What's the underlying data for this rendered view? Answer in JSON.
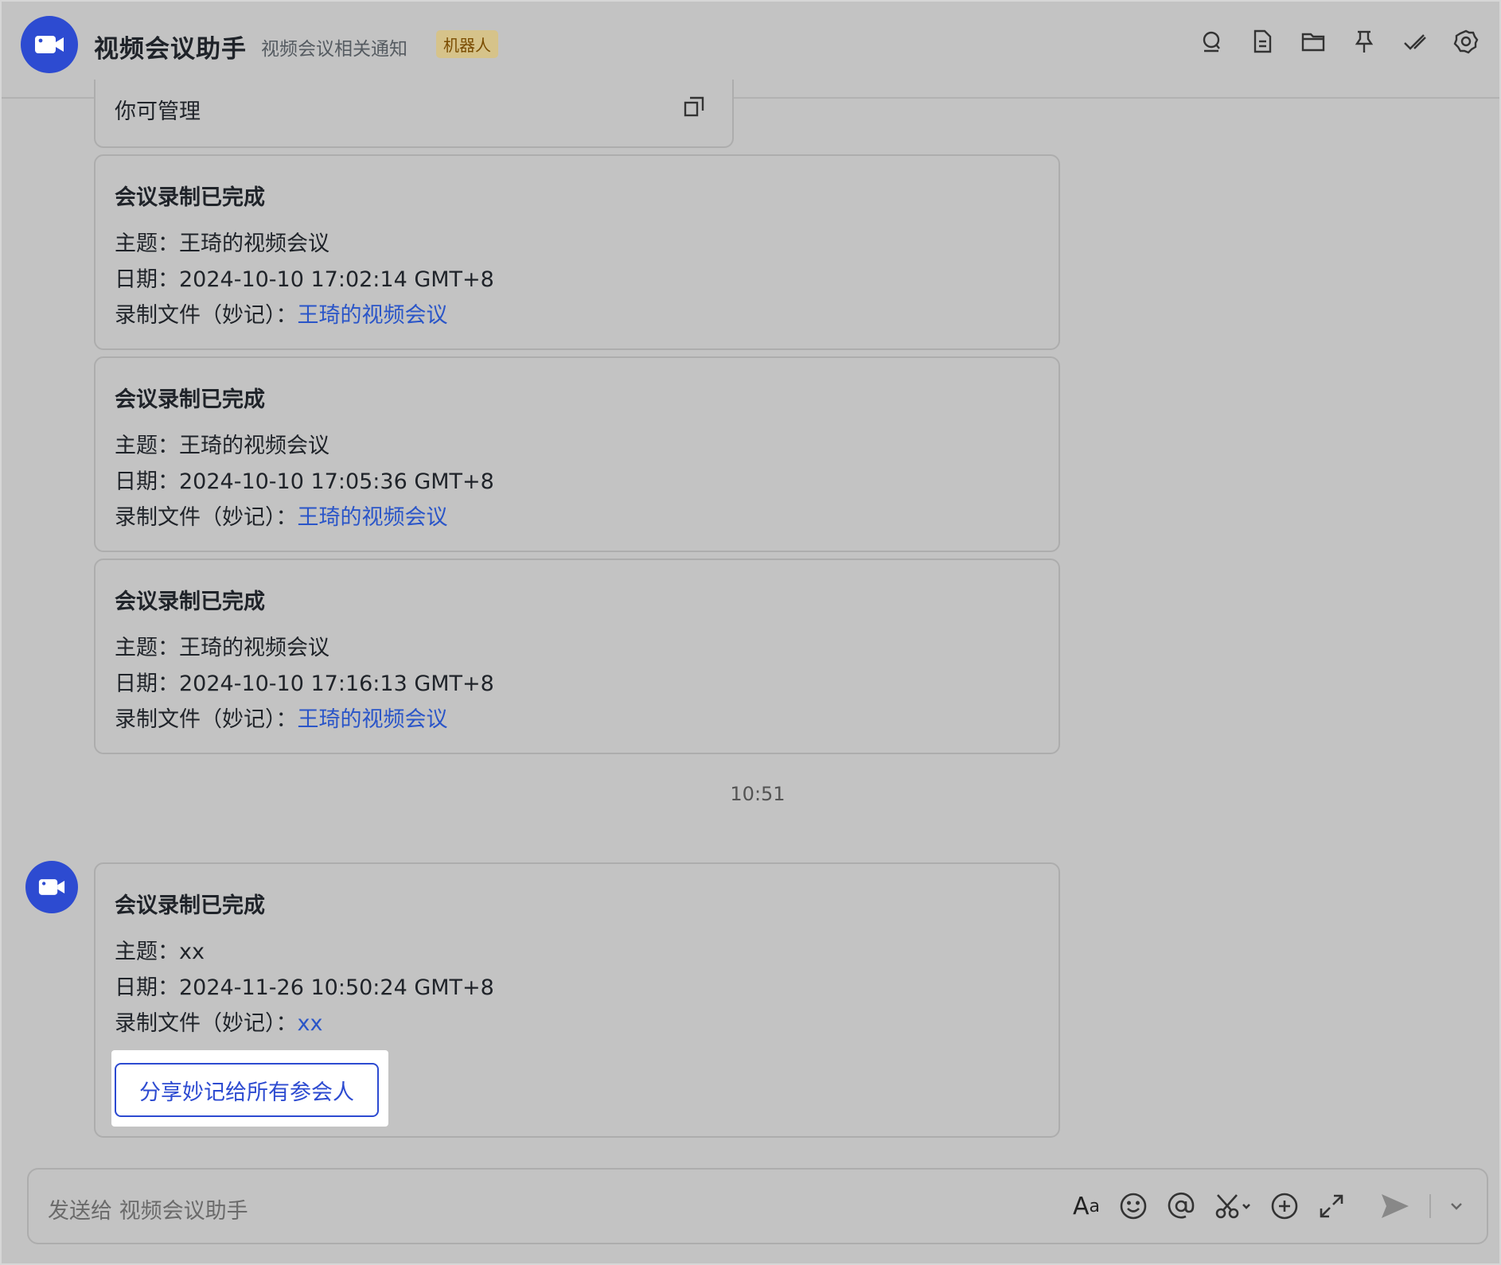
{
  "header": {
    "title": "视频会议助手",
    "subtitle": "视频会议相关通知",
    "badge": "机器人",
    "icons": [
      "search-icon",
      "document-icon",
      "folder-icon",
      "pin-icon",
      "check-all-icon",
      "settings-icon"
    ]
  },
  "top_card": {
    "text": "你可管理",
    "icon": "copy-icon"
  },
  "messages": [
    {
      "title": "会议录制已完成",
      "topic_label": "主题：",
      "topic": "王琦的视频会议",
      "date_label": "日期：",
      "date": "2024-10-10 17:02:14 GMT+8",
      "file_label": "录制文件（妙记）：",
      "file_link": "王琦的视频会议"
    },
    {
      "title": "会议录制已完成",
      "topic_label": "主题：",
      "topic": "王琦的视频会议",
      "date_label": "日期：",
      "date": "2024-10-10 17:05:36 GMT+8",
      "file_label": "录制文件（妙记）：",
      "file_link": "王琦的视频会议"
    },
    {
      "title": "会议录制已完成",
      "topic_label": "主题：",
      "topic": "王琦的视频会议",
      "date_label": "日期：",
      "date": "2024-10-10 17:16:13 GMT+8",
      "file_label": "录制文件（妙记）：",
      "file_link": "王琦的视频会议"
    }
  ],
  "timestamp": "10:51",
  "last_message": {
    "title": "会议录制已完成",
    "topic_label": "主题：",
    "topic": "xx",
    "date_label": "日期：",
    "date": "2024-11-26 10:50:24 GMT+8",
    "file_label": "录制文件（妙记）：",
    "file_link": "xx",
    "share_button": "分享妙记给所有参会人"
  },
  "composer": {
    "placeholder": "发送给 视频会议助手",
    "format_label_big": "A",
    "format_label_small": "a",
    "tools": [
      "format-icon",
      "emoji-icon",
      "mention-icon",
      "scissors-icon",
      "add-icon",
      "expand-icon",
      "send-icon",
      "dropdown-icon"
    ]
  },
  "colors": {
    "brand": "#2d4bd1",
    "link": "#2a55c8",
    "badge_bg": "#d6c38a",
    "badge_text": "#7a4c00"
  }
}
